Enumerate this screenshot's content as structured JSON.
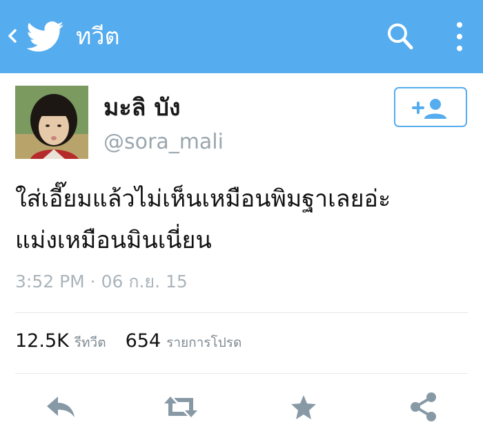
{
  "header": {
    "title": "ทวีต",
    "back_icon": "chevron-left-icon",
    "logo_icon": "twitter-bird-icon",
    "search_icon": "search-icon",
    "more_icon": "vertical-dots-icon",
    "background_color": "#55acee"
  },
  "tweet": {
    "display_name": "มะลิ บัง",
    "handle": "@sora_mali",
    "text_lines": [
      "ใส่เอี๊ยมแล้วไม่เห็นเหมือนพิมฐาเลยอ่ะ",
      "แม่งเหมือนมินเนี่ยน"
    ],
    "timestamp": "3:52 PM · 06 ก.ย. 15",
    "follow_icon": "add-user-icon"
  },
  "stats": {
    "retweets_count": "12.5K",
    "retweets_label": "รีทวีต",
    "favorites_count": "654",
    "favorites_label": "รายการโปรด"
  },
  "actions": {
    "reply_icon": "reply-icon",
    "retweet_icon": "retweet-icon",
    "favorite_icon": "star-icon",
    "share_icon": "share-icon",
    "icon_color": "#8899a6"
  }
}
